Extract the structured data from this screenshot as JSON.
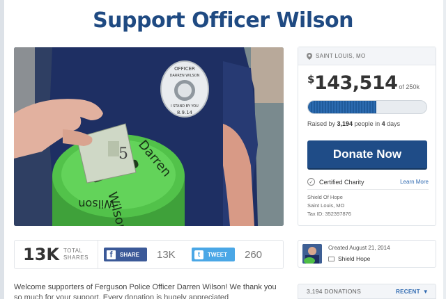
{
  "page": {
    "title": "Support Officer Wilson"
  },
  "photo": {
    "badge_top": "OFFICER",
    "badge_name": "DARREN WILSON",
    "badge_motto": "I STAND BY YOU",
    "badge_date": "8.9.14",
    "jar_text_1": "Darren",
    "jar_text_2": "Wilson",
    "jar_text_3": "Wilson",
    "bill_text": "5"
  },
  "shares": {
    "total": "13K",
    "total_label_1": "TOTAL",
    "total_label_2": "SHARES",
    "facebook_label": "SHARE",
    "facebook_count": "13K",
    "twitter_label": "TWEET",
    "twitter_count": "260"
  },
  "story": {
    "line1": "Welcome supporters of Ferguson Police Officer Darren Wilson!  We thank you",
    "line2": "so much for your support. Every donation is hugely appreciated"
  },
  "campaign": {
    "location": "SAINT LOUIS, MO",
    "currency": "$",
    "raised": "143,514",
    "goal": "of 250k",
    "progress_fraction": 0.574,
    "raised_by_prefix": "Raised by ",
    "people": "3,194",
    "raised_by_mid": " people in ",
    "days": "4",
    "raised_by_suffix": " days",
    "donate_label": "Donate Now",
    "certified_label": "Certified Charity",
    "learn_more": "Learn More",
    "charity_name": "Shield Of Hope",
    "charity_city": "Saint Louis, MO",
    "tax_id": "Tax ID: 352397876"
  },
  "creator": {
    "created": "Created August 21, 2014",
    "name": "Shield Hope"
  },
  "donations": {
    "count_label": "3,194 DONATIONS",
    "sort_label": "RECENT"
  },
  "colors": {
    "title": "#1f4a82",
    "donate": "#1f4c87",
    "facebook": "#3b5998",
    "twitter": "#4aa7e6",
    "link": "#2d68b0"
  }
}
